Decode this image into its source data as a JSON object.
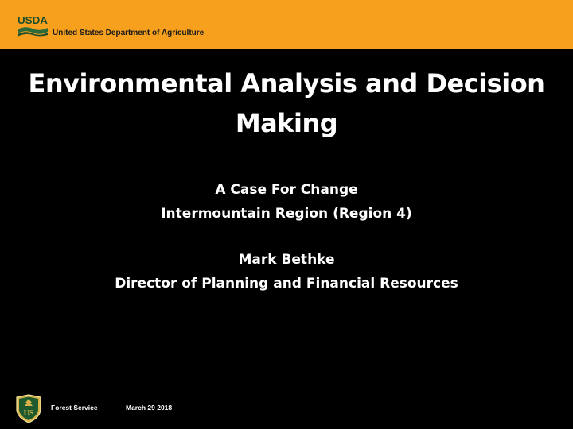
{
  "header": {
    "logo_text": "USDA",
    "agency_name": "United States Department of Agriculture",
    "band_color": "#F7A01E"
  },
  "slide": {
    "title": "Environmental Analysis and Decision Making",
    "subtitle_lines": [
      "A Case For Change",
      "Intermountain Region (Region 4)"
    ],
    "presenter_name": "Mark Bethke",
    "presenter_title": "Director of Planning and Financial Resources"
  },
  "footer": {
    "emblem_text": "US",
    "service": "Forest Service",
    "date": "March 29 2018"
  }
}
